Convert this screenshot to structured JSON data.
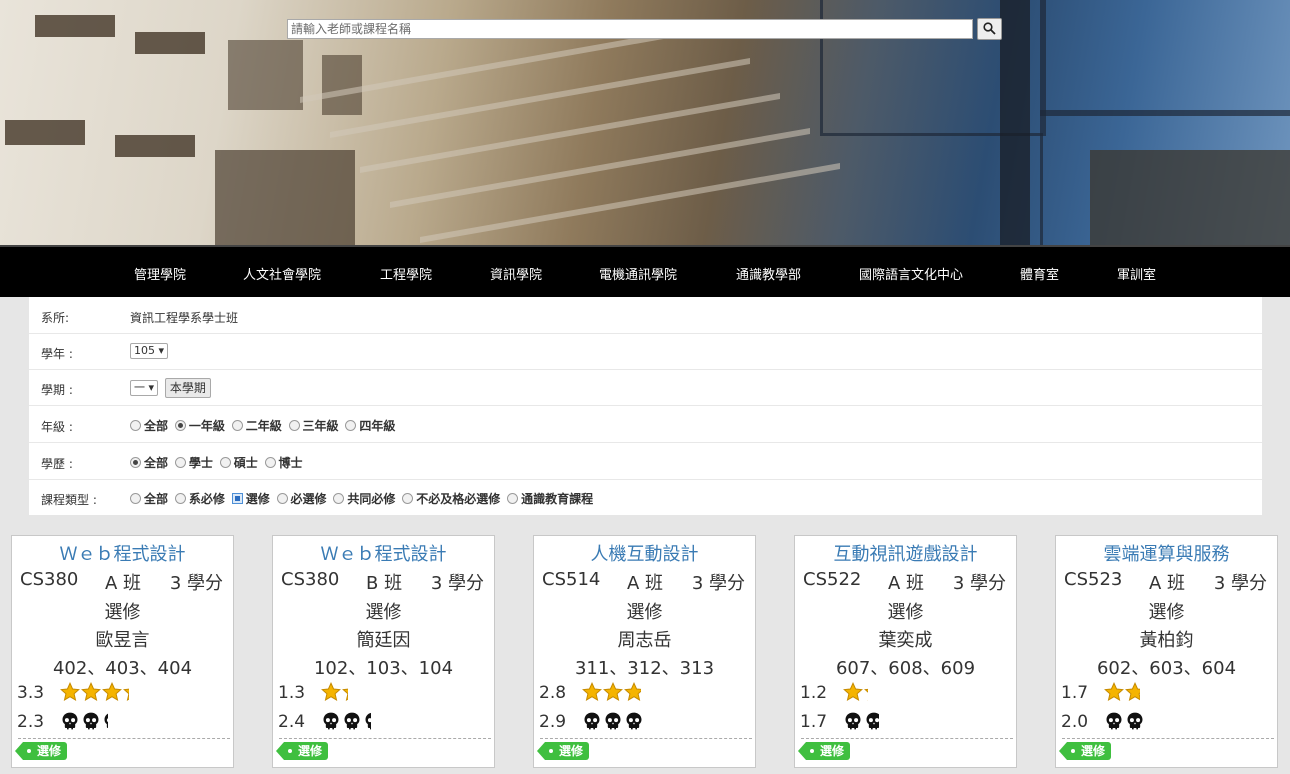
{
  "search": {
    "placeholder": "請輸入老師或課程名稱"
  },
  "nav": [
    "管理學院",
    "人文社會學院",
    "工程學院",
    "資訊學院",
    "電機通訊學院",
    "通識教學部",
    "國際語言文化中心",
    "體育室",
    "軍訓室"
  ],
  "filters": {
    "dept": {
      "label": "系所:",
      "value": "資訊工程學系學士班"
    },
    "year": {
      "label": "學年 :",
      "value": "105"
    },
    "semester": {
      "label": "學期 :",
      "value": "一",
      "button": "本學期"
    },
    "grade": {
      "label": "年級 :",
      "options": [
        "全部",
        "一年級",
        "二年級",
        "三年級",
        "四年級"
      ],
      "selected": "一年級"
    },
    "degree": {
      "label": "學歷 :",
      "options": [
        "全部",
        "學士",
        "碩士",
        "博士"
      ],
      "selected": "全部"
    },
    "course_type": {
      "label": "課程類型 :",
      "options": [
        "全部",
        "系必修",
        "選修",
        "必選修",
        "共同必修",
        "不必及格必選修",
        "通識教育課程"
      ],
      "selected": "選修"
    }
  },
  "cards": [
    {
      "title": "Ｗｅｂ程式設計",
      "code": "CS380",
      "class": "A 班",
      "credits": "3 學分",
      "type": "選修",
      "teacher": "歐昱言",
      "rooms": "402、403、404",
      "rating": "3.3",
      "difficulty": "2.3",
      "tag": "選修"
    },
    {
      "title": "Ｗｅｂ程式設計",
      "code": "CS380",
      "class": "B 班",
      "credits": "3 學分",
      "type": "選修",
      "teacher": "簡廷因",
      "rooms": "102、103、104",
      "rating": "1.3",
      "difficulty": "2.4",
      "tag": "選修"
    },
    {
      "title": "人機互動設計",
      "code": "CS514",
      "class": "A 班",
      "credits": "3 學分",
      "type": "選修",
      "teacher": "周志岳",
      "rooms": "311、312、313",
      "rating": "2.8",
      "difficulty": "2.9",
      "tag": "選修"
    },
    {
      "title": "互動視訊遊戲設計",
      "code": "CS522",
      "class": "A 班",
      "credits": "3 學分",
      "type": "選修",
      "teacher": "葉奕成",
      "rooms": "607、608、609",
      "rating": "1.2",
      "difficulty": "1.7",
      "tag": "選修"
    },
    {
      "title": "雲端運算與服務",
      "code": "CS523",
      "class": "A 班",
      "credits": "3 學分",
      "type": "選修",
      "teacher": "黃柏鈞",
      "rooms": "602、603、604",
      "rating": "1.7",
      "difficulty": "2.0",
      "tag": "選修"
    }
  ]
}
